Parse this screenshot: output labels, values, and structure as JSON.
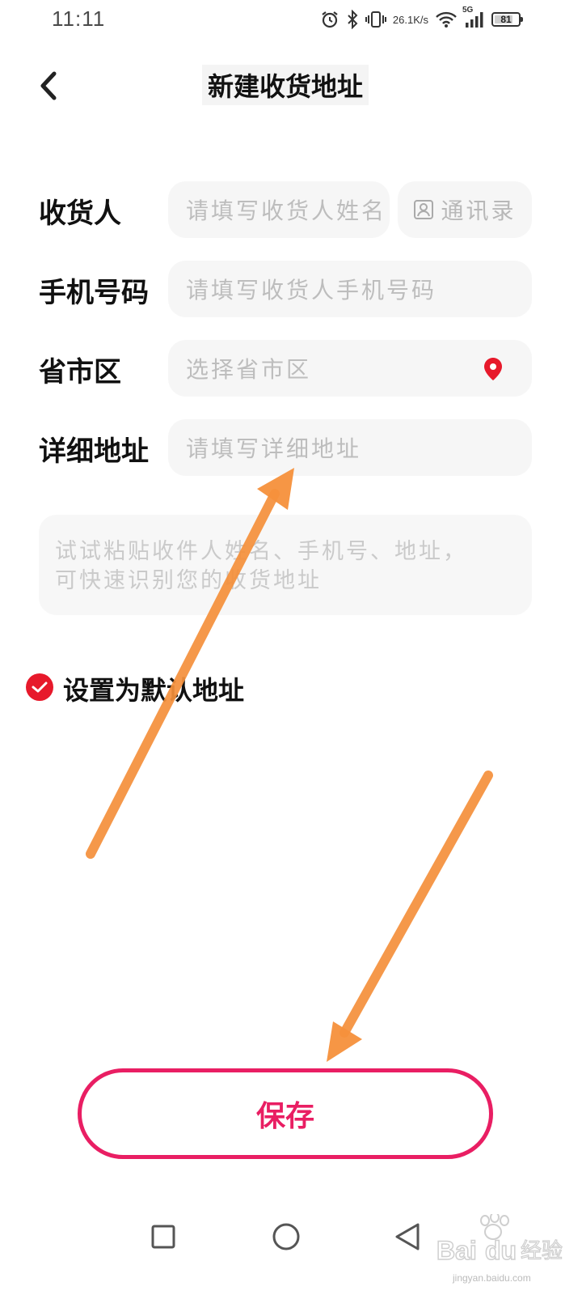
{
  "status_bar": {
    "time": "11:11",
    "speed_value": "26.1",
    "speed_unit": "K/s",
    "network": "5G",
    "battery": "81"
  },
  "header": {
    "title": "新建收货地址"
  },
  "form": {
    "recipient": {
      "label": "收货人",
      "placeholder": "请填写收货人姓名"
    },
    "contacts_button": "通讯录",
    "phone": {
      "label": "手机号码",
      "placeholder": "请填写收货人手机号码"
    },
    "region": {
      "label": "省市区",
      "placeholder": "选择省市区"
    },
    "detail": {
      "label": "详细地址",
      "placeholder": "请填写详细地址"
    },
    "paste_hint_line1": "试试粘贴收件人姓名、手机号、地址，",
    "paste_hint_line2": "可快速识别您的收货地址",
    "default_address": {
      "label": "设置为默认地址",
      "checked": true
    }
  },
  "save_button": "保存",
  "colors": {
    "accent_red": "#e7192b",
    "save_pink": "#e91e63",
    "arrow_orange": "#f5903b"
  }
}
